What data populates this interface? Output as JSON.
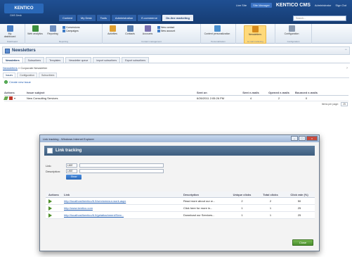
{
  "app": {
    "logo_text": "KENTICO",
    "logo_sub": "CMS Desk",
    "title": "KENTICO CMS",
    "user_links": [
      "Live Site",
      "Site Manager",
      "Sign Out"
    ],
    "user_name": "Administrator",
    "menu_tabs": [
      {
        "label": "Content",
        "active": false
      },
      {
        "label": "My Desk",
        "active": false
      },
      {
        "label": "Tools",
        "active": false
      },
      {
        "label": "Administration",
        "active": false
      },
      {
        "label": "E-commerce",
        "active": false
      },
      {
        "label": "On-line marketing",
        "active": true
      }
    ],
    "search_placeholder": "Search..."
  },
  "ribbon": {
    "groups": [
      {
        "label": "Dashboard",
        "buttons": [
          {
            "label": "My dashboard",
            "icon": "dashboard-icon",
            "selected": false
          }
        ]
      },
      {
        "label": "Reporting",
        "buttons": [
          {
            "label": "Web analytics",
            "icon": "analytics-icon",
            "selected": false
          },
          {
            "label": "Reporting",
            "icon": "reporting-icon",
            "selected": false
          }
        ],
        "small": [
          "Conversions",
          "Campaigns"
        ]
      },
      {
        "label": "Contact management",
        "buttons": [
          {
            "label": "Activities",
            "icon": "activities-icon",
            "selected": false
          },
          {
            "label": "Contacts",
            "icon": "contacts-icon",
            "selected": false
          },
          {
            "label": "Accounts",
            "icon": "accounts-icon",
            "selected": false
          }
        ],
        "small": [
          "New contact",
          "New account"
        ]
      },
      {
        "label": "Personalization",
        "buttons": [
          {
            "label": "Content personalization",
            "icon": "personalization-icon",
            "selected": false
          }
        ]
      },
      {
        "label": "E-mail marketing",
        "buttons": [
          {
            "label": "Newsletters",
            "icon": "newsletters-icon",
            "selected": true
          }
        ]
      },
      {
        "label": "Configuration",
        "buttons": [
          {
            "label": "Configuration",
            "icon": "configuration-icon",
            "selected": false
          }
        ]
      }
    ]
  },
  "page": {
    "title": "Newsletters",
    "tabs": [
      {
        "label": "Newsletters",
        "active": true
      },
      {
        "label": "Subscribers",
        "active": false
      },
      {
        "label": "Templates",
        "active": false
      },
      {
        "label": "Newsletter queue",
        "active": false
      },
      {
        "label": "Import subscribers",
        "active": false
      },
      {
        "label": "Export subscribers",
        "active": false
      }
    ],
    "breadcrumb_link": "Newsletters",
    "breadcrumb_sep": "»",
    "breadcrumb_current": "Corporate Newsletter",
    "inner_tabs": [
      {
        "label": "Issues",
        "active": true
      },
      {
        "label": "Configuration",
        "active": false
      },
      {
        "label": "Subscribers",
        "active": false
      }
    ],
    "create_label": "Create new issue"
  },
  "issues_grid": {
    "columns": [
      "Actions",
      "Issue subject",
      "Sent on",
      "Sent e-mails",
      "Opened e-mails",
      "Bounced e-mails"
    ],
    "rows": [
      {
        "subject": "New Consulting Services",
        "sent_on": "6/26/2011 2:05:26 PM",
        "sent": "4",
        "opened": "2",
        "bounced": "0"
      }
    ],
    "page_size_label": "Items per page:",
    "page_size": "25"
  },
  "modal": {
    "window_title": "Link tracking - Windows Internet Explorer",
    "header": "Link tracking",
    "link_label": "Link:",
    "link_op": "LIKE",
    "desc_label": "Description:",
    "desc_op": "LIKE",
    "show_button": "Show",
    "columns": [
      "Actions",
      "Link",
      "Description",
      "Unique clicks",
      "Total clicks",
      "Click rate (%)"
    ],
    "rows": [
      {
        "link": "http://localhost/kentico/6.0/services/our-work.aspx",
        "description": "Read more about our w...",
        "unique": "2",
        "total": "2",
        "rate": "50"
      },
      {
        "link": "http://www.kentico.com",
        "description": "Click here for more in...",
        "unique": "1",
        "total": "1",
        "rate": "25"
      },
      {
        "link": "http://localhost/kentico/6.0/getattachment/Serv...",
        "description": "Download our Services...",
        "unique": "1",
        "total": "1",
        "rate": "25"
      }
    ],
    "close_button": "Close"
  }
}
